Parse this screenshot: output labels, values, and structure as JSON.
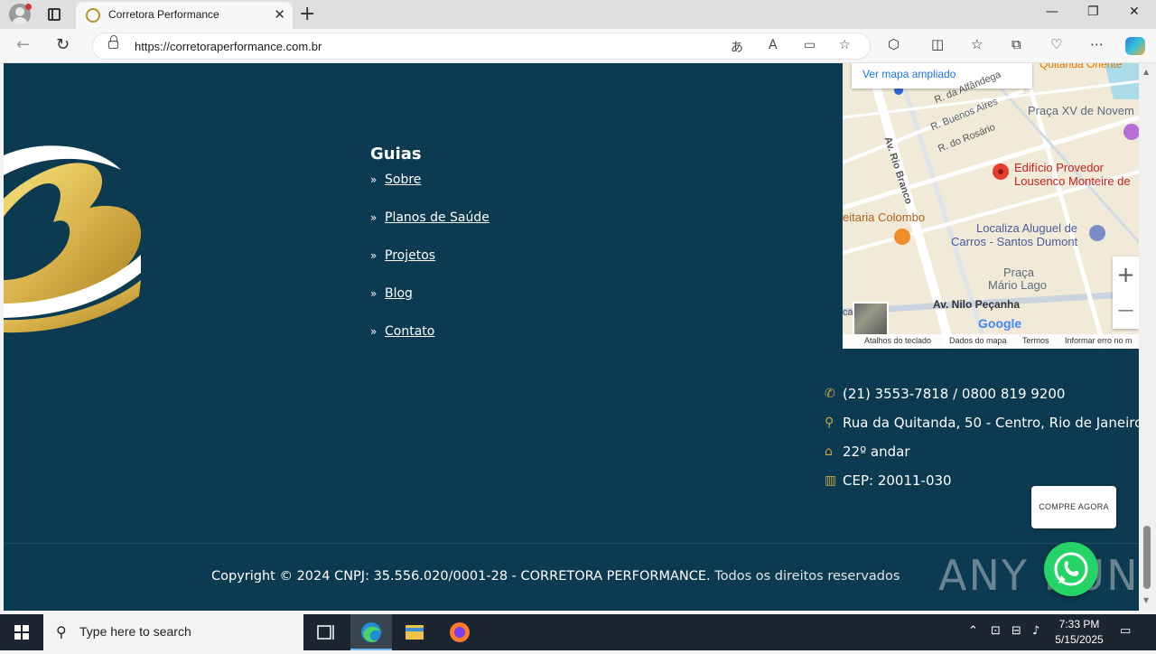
{
  "browser": {
    "tab_title": "Corretora Performance",
    "tab_close": "✕",
    "new_tab": "+",
    "url": "https://corretoraperformance.com.br",
    "window_controls": {
      "minimize": "—",
      "restore": "❐",
      "close": "✕"
    }
  },
  "footer": {
    "guias_title": "Guias",
    "guias_links": [
      "Sobre",
      "Planos de Saúde",
      "Projetos",
      "Blog",
      "Contato"
    ],
    "contact": {
      "phone": "(21) 3553-7818 / 0800 819 9200",
      "address": "Rua da Quitanda, 50 - Centro, Rio de Janeiro",
      "floor": "22º andar",
      "cep": "CEP: 20011-030"
    },
    "buy_button": "COMPRE AGORA",
    "copyright_main": "Copyright © 2024  CNPJ: 35.556.020/0001-28 - CORRETORA PERFORMANCE.",
    "copyright_rest": " Todos os direitos reservados"
  },
  "map": {
    "view_larger": "Ver mapa ampliado",
    "labels": {
      "building": "Edifício Provedor",
      "building2": "Lousenco Monteire de",
      "praca_xv": "Praça XV de Novem",
      "colombo": "eitaria Colombo",
      "localiza1": "Localiza Aluguel de",
      "localiza2": "Carros - Santos Dumont",
      "mario_lago1": "Praça",
      "mario_lago2": "Mário Lago",
      "nilo": "Av. Nilo Peçanha",
      "rio_branco": "Av. Rio Branco",
      "buenos_aires": "R. Buenos Aires",
      "rosario": "R. do Rosário",
      "alfandega": "R. da Alfândega",
      "top_place": "Quitanda Oriente",
      "ca": "ca"
    },
    "attribution": [
      "Atalhos do teclado",
      "Dados do mapa",
      "Termos",
      "Informar erro no m"
    ],
    "google": "Google",
    "zoom_in": "+",
    "zoom_out": "—"
  },
  "watermark": "ANY  RUN",
  "taskbar": {
    "search_placeholder": "Type here to search",
    "time": "7:33 PM",
    "date": "5/15/2025"
  },
  "colors": {
    "footer_bg": "#0c3a50",
    "accent_gold": "#c9a24a",
    "whatsapp_green": "#25d366"
  }
}
